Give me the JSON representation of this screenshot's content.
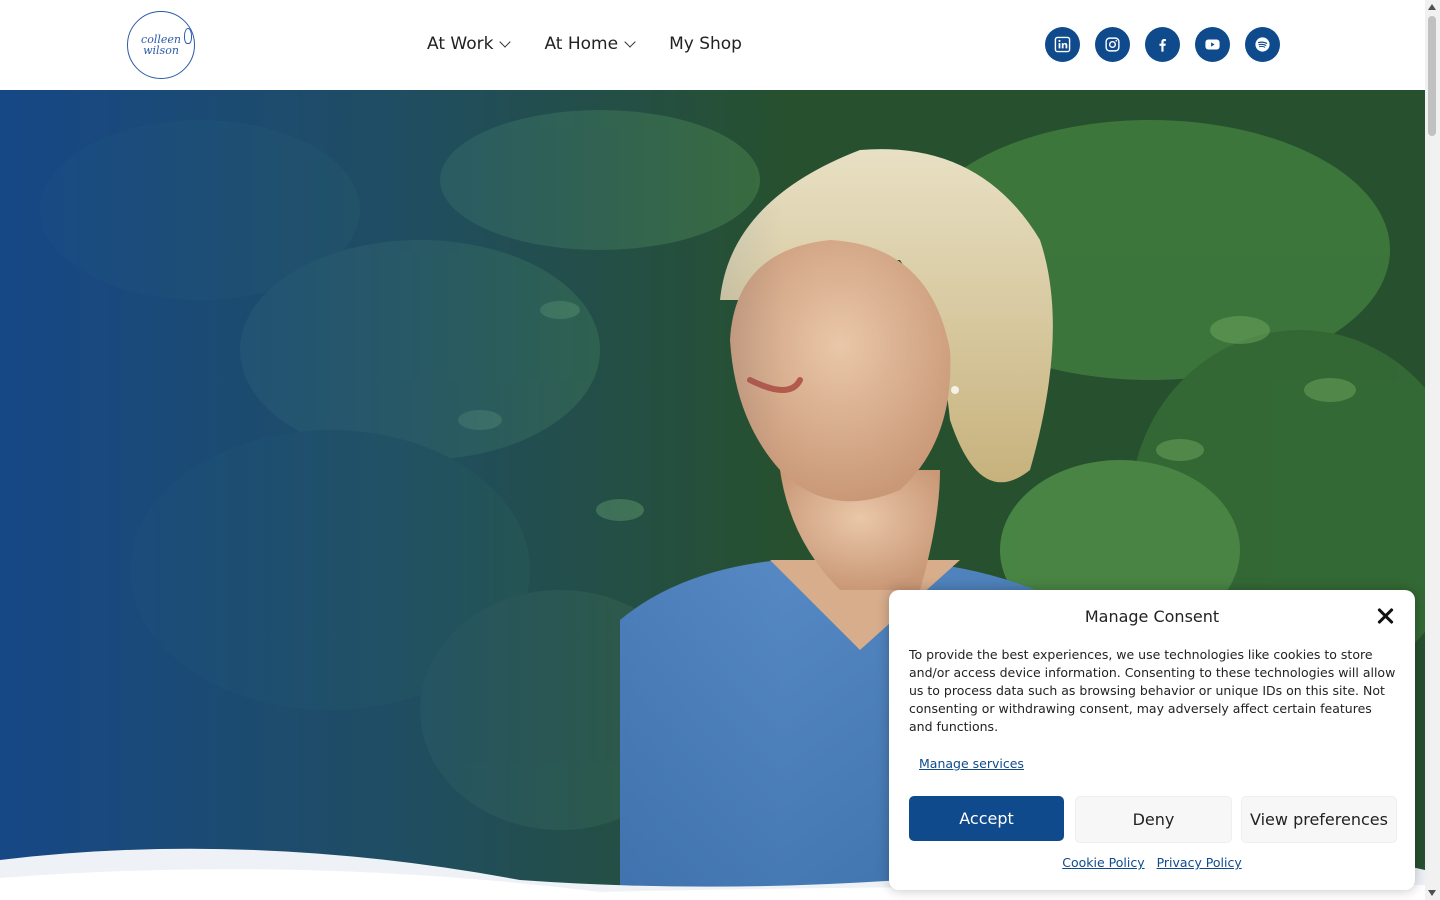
{
  "logo": {
    "line1": "colleen",
    "line2": "wilson"
  },
  "nav": {
    "items": [
      {
        "label": "At Work",
        "has_dropdown": true
      },
      {
        "label": "At Home",
        "has_dropdown": true
      },
      {
        "label": "My Shop",
        "has_dropdown": false
      }
    ]
  },
  "socials": [
    "linkedin-icon",
    "instagram-icon",
    "facebook-icon",
    "youtube-icon",
    "spotify-icon"
  ],
  "colors": {
    "brand": "#0f4a8c",
    "logo": "#2a5aa8"
  },
  "hero": {
    "image": "woman-smiling-in-front-of-leafy-vines-photo"
  },
  "consent": {
    "title": "Manage Consent",
    "body": "To provide the best experiences, we use technologies like cookies to store and/or access device information. Consenting to these technologies will allow us to process data such as browsing behavior or unique IDs on this site. Not consenting or withdrawing consent, may adversely affect certain features and functions.",
    "manage_services": "Manage services",
    "accept": "Accept",
    "deny": "Deny",
    "view_preferences": "View preferences",
    "cookie_policy": "Cookie Policy",
    "privacy_policy": "Privacy Policy"
  }
}
